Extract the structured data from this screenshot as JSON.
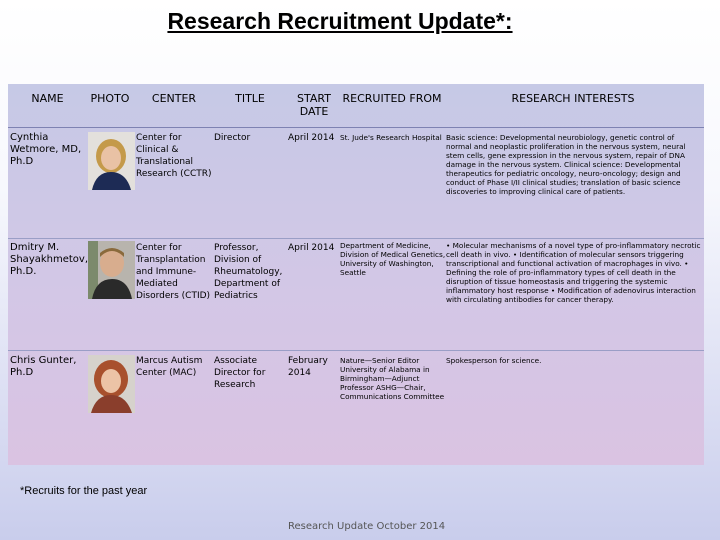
{
  "title": "Research Recruitment Update*:",
  "headers": {
    "name": "NAME",
    "photo": "PHOTO",
    "center": "CENTER",
    "title": "TITLE",
    "start_date": "START DATE",
    "recruited_from": "RECRUITED FROM",
    "research_interests": "RESEARCH INTERESTS"
  },
  "rows": [
    {
      "name": "Cynthia Wetmore, MD, Ph.D",
      "center": "Center for Clinical & Translational Research (CCTR)",
      "title": "Director",
      "start_date": "April 2014",
      "recruited_from": "St. Jude's Research Hospital",
      "research_interests": "Basic science: Developmental neurobiology, genetic control of normal and neoplastic proliferation in the nervous system, neural stem cells, gene expression in the nervous system, repair of DNA damage in the nervous system. Clinical science: Developmental therapeutics for pediatric oncology, neuro-oncology; design and conduct of Phase I/II clinical studies; translation of basic science discoveries to improving clinical care of patients."
    },
    {
      "name": "Dmitry M. Shayakhmetov, Ph.D.",
      "center": "Center for Transplantation and Immune-Mediated Disorders (CTID)",
      "title": "Professor, Division of Rheumatology, Department of Pediatrics",
      "start_date": "April 2014",
      "recruited_from": "Department of Medicine, Division of Medical Genetics, University of Washington, Seattle",
      "research_interests": "• Molecular mechanisms of a novel type of pro-inflammatory necrotic cell death in vivo. • Identification of molecular sensors triggering transcriptional and functional activation of macrophages in vivo. • Defining the role of pro-inflammatory types of cell death in the disruption of tissue homeostasis and triggering the systemic inflammatory host response • Modification of adenovirus interaction with circulating antibodies for cancer therapy."
    },
    {
      "name": "Chris Gunter, Ph.D",
      "center": "Marcus Autism Center (MAC)",
      "title": "Associate Director for Research",
      "start_date": "February 2014",
      "recruited_from": "Nature—Senior Editor University of Alabama in Birmingham—Adjunct Professor ASHG—Chair, Communications Committee",
      "research_interests": "Spokesperson for science."
    }
  ],
  "footnote": "*Recruits for the past year",
  "footer": "Research Update October 2014"
}
